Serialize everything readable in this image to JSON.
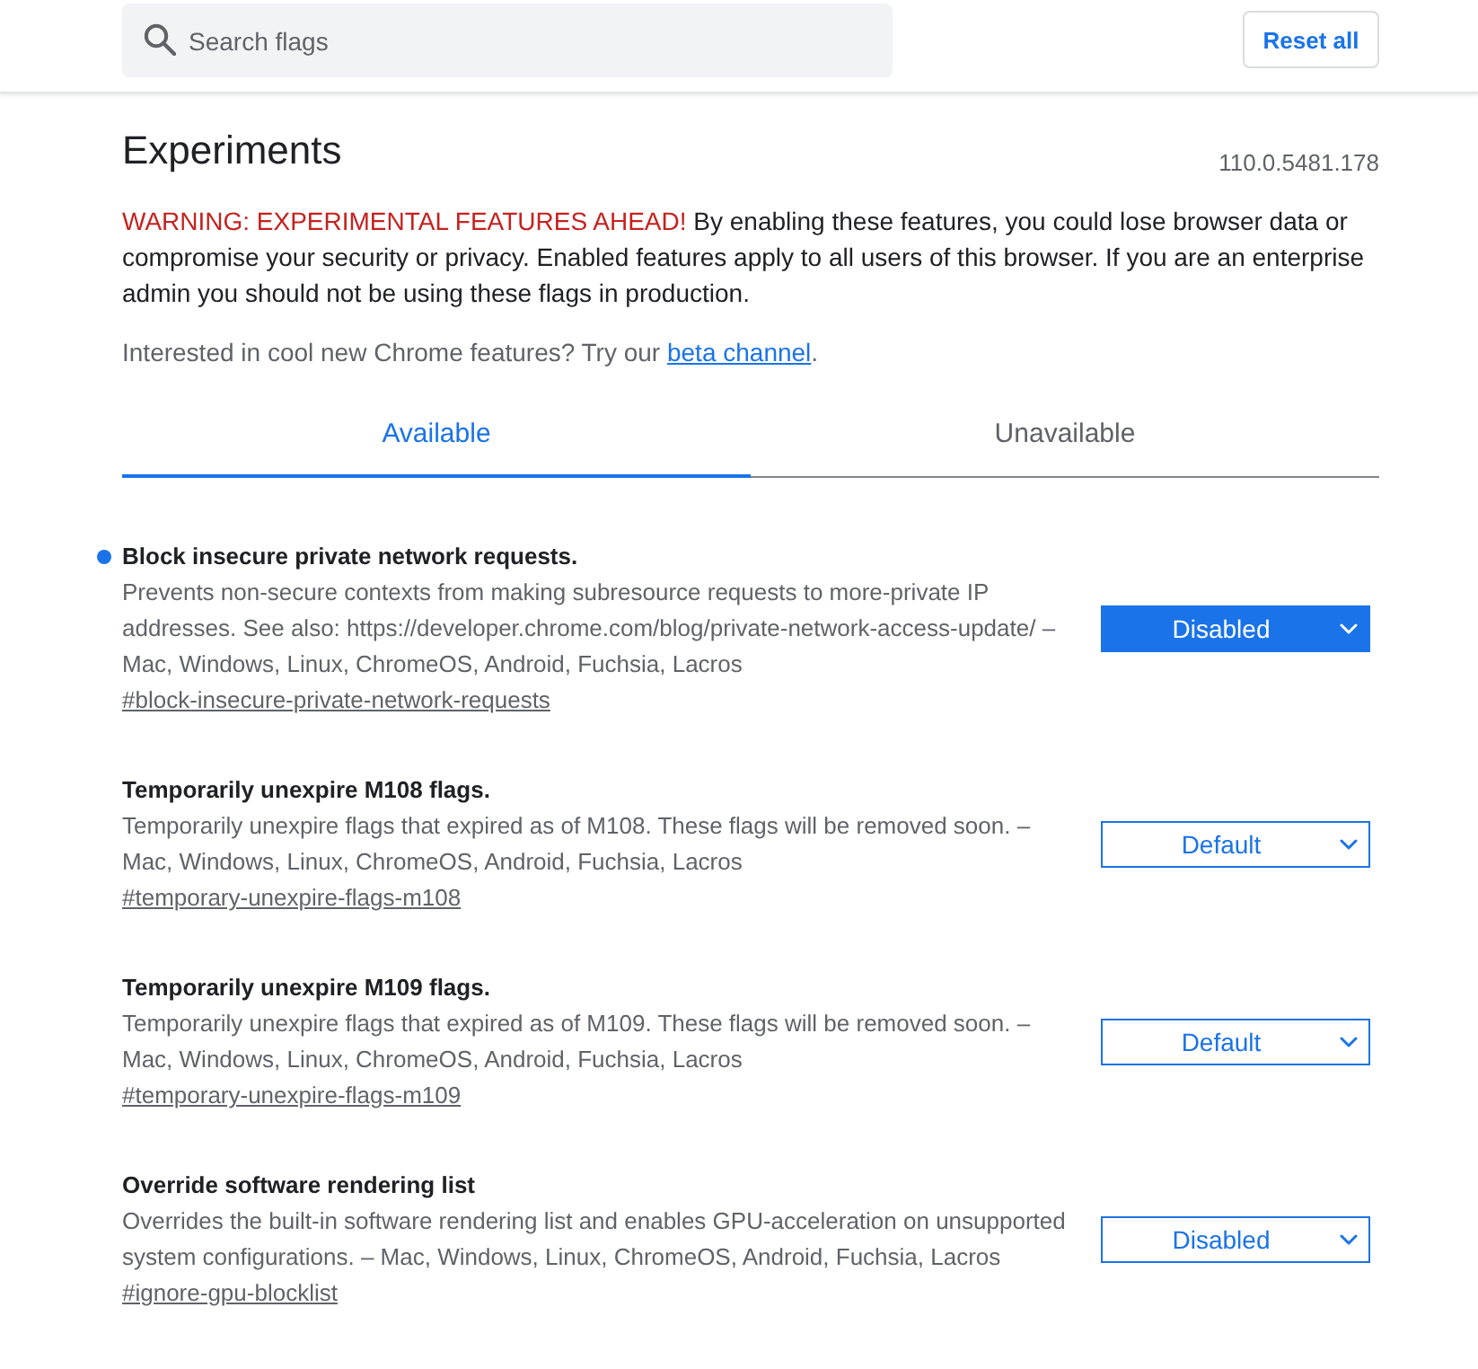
{
  "search": {
    "placeholder": "Search flags"
  },
  "reset_button": {
    "label": "Reset all"
  },
  "heading": {
    "title": "Experiments",
    "version": "110.0.5481.178"
  },
  "warning": {
    "label": "WARNING: EXPERIMENTAL FEATURES AHEAD!",
    "text": "By enabling these features, you could lose browser data or compromise your security or privacy. Enabled features apply to all users of this browser. If you are an enterprise admin you should not be using these flags in production."
  },
  "promo": {
    "text": "Interested in cool new Chrome features? Try our",
    "link": "beta channel",
    "after": "."
  },
  "tabs": [
    {
      "label": "Available",
      "selected": true
    },
    {
      "label": "Unavailable",
      "selected": false
    }
  ],
  "flags": [
    {
      "title": "Block insecure private network requests.",
      "description": "Prevents non-secure contexts from making subresource requests to more-private IP addresses. See also: https://developer.chrome.com/blog/private-network-access-update/ – Mac, Windows, Linux, ChromeOS, Android, Fuchsia, Lacros",
      "link": "#block-insecure-private-network-requests",
      "value": "Disabled",
      "modified": true
    },
    {
      "title": "Temporarily unexpire M108 flags.",
      "description": "Temporarily unexpire flags that expired as of M108. These flags will be removed soon. – Mac, Windows, Linux, ChromeOS, Android, Fuchsia, Lacros",
      "link": "#temporary-unexpire-flags-m108",
      "value": "Default",
      "modified": false
    },
    {
      "title": "Temporarily unexpire M109 flags.",
      "description": "Temporarily unexpire flags that expired as of M109. These flags will be removed soon. – Mac, Windows, Linux, ChromeOS, Android, Fuchsia, Lacros",
      "link": "#temporary-unexpire-flags-m109",
      "value": "Default",
      "modified": false
    },
    {
      "title": "Override software rendering list",
      "description": "Overrides the built-in software rendering list and enables GPU-acceleration on unsupported system configurations. – Mac, Windows, Linux, ChromeOS, Android, Fuchsia, Lacros",
      "link": "#ignore-gpu-blocklist",
      "value": "Disabled",
      "modified": false
    }
  ]
}
